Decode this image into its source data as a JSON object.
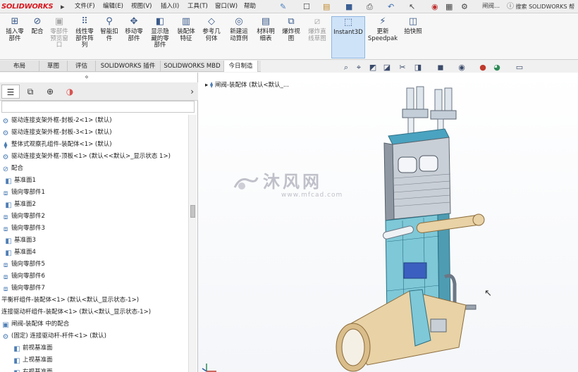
{
  "app": {
    "logo": "SOLIDWORKS"
  },
  "menu": [
    "文件(F)",
    "编辑(E)",
    "视图(V)",
    "插入(I)",
    "工具(T)",
    "窗口(W)",
    "帮助"
  ],
  "window_title": "闸阀...",
  "search_placeholder": "搜索 SOLIDWORKS 帮",
  "ribbon": [
    {
      "label": "插入零\n部件",
      "icon": "insert-component-icon",
      "enabled": true
    },
    {
      "label": "配合",
      "icon": "mate-icon",
      "enabled": true
    },
    {
      "label": "零部件\n预览窗\n口",
      "icon": "preview-window-icon",
      "enabled": false
    },
    {
      "label": "线性零\n部件阵\n列",
      "icon": "linear-pattern-icon",
      "enabled": true
    },
    {
      "label": "智能扣\n件",
      "icon": "smart-fastener-icon",
      "enabled": true
    },
    {
      "label": "移动零\n部件",
      "icon": "move-component-icon",
      "enabled": true
    },
    {
      "label": "显示隐\n藏的零\n部件",
      "icon": "show-hidden-icon",
      "enabled": true
    },
    {
      "label": "装配体\n特征",
      "icon": "assembly-feature-icon",
      "enabled": true
    },
    {
      "label": "参考几\n何体",
      "icon": "reference-geometry-icon",
      "enabled": true
    },
    {
      "label": "新建运\n动算例",
      "icon": "motion-study-icon",
      "enabled": true
    },
    {
      "label": "材料明\n细表",
      "icon": "bom-icon",
      "enabled": true
    },
    {
      "label": "爆炸视\n图",
      "icon": "exploded-view-icon",
      "enabled": true
    },
    {
      "label": "爆炸直\n线草图",
      "icon": "explode-line-icon",
      "enabled": false
    },
    {
      "label": "Instant3D",
      "icon": "instant3d-icon",
      "enabled": true,
      "selected": true
    },
    {
      "label": "更新\nSpeedpak",
      "icon": "speedpak-icon",
      "enabled": true
    },
    {
      "label": "拍快照",
      "icon": "snapshot-icon",
      "enabled": true
    }
  ],
  "tabs": [
    {
      "label": "布局",
      "active": false
    },
    {
      "label": "草图",
      "active": false
    },
    {
      "label": "评估",
      "active": false
    },
    {
      "label": "SOLIDWORKS 插件",
      "active": false
    },
    {
      "label": "SOLIDWORKS MBD",
      "active": false
    },
    {
      "label": "今日制造",
      "active": true
    }
  ],
  "tree": [
    {
      "label": "驱动连接支架外框-封板-2<1> (默认)",
      "icon": "part-icon"
    },
    {
      "label": "驱动连接支架外框-封板-3<1> (默认)",
      "icon": "part-icon"
    },
    {
      "label": "整体式观察孔组件-装配体<1> (默认)",
      "icon": "assembly-icon"
    },
    {
      "label": "驱动连接支架外框-顶板<1> (默认<<默认>_显示状态 1>)",
      "icon": "part-icon"
    },
    {
      "label": "配合",
      "icon": "mate-icon"
    },
    {
      "label": "基准面1",
      "icon": "plane-icon"
    },
    {
      "label": "镜向零部件1",
      "icon": "mirror-icon"
    },
    {
      "label": "基准面2",
      "icon": "plane-icon"
    },
    {
      "label": "镜向零部件2",
      "icon": "mirror-icon"
    },
    {
      "label": "镜向零部件3",
      "icon": "mirror-icon"
    },
    {
      "label": "基准面3",
      "icon": "plane-icon"
    },
    {
      "label": "基准面4",
      "icon": "plane-icon"
    },
    {
      "label": "镜向零部件5",
      "icon": "mirror-icon"
    },
    {
      "label": "镜向零部件6",
      "icon": "mirror-icon"
    },
    {
      "label": "镜向零部件7",
      "icon": "mirror-icon"
    },
    {
      "label": "平衡杆组件-装配体<1> (默认<默认_显示状态-1>)",
      "icon": "none"
    },
    {
      "label": "连接驱动杆组件-装配体<1> (默认<默认_显示状态-1>)",
      "icon": "none"
    },
    {
      "label": "闸阀-装配体 中的配合",
      "icon": "mate-folder-icon"
    },
    {
      "label": "(固定) 连接驱动杆-杆件<1> (默认)",
      "icon": "part-icon"
    },
    {
      "label": "前视基准面",
      "icon": "plane-icon"
    },
    {
      "label": "上视基准面",
      "icon": "plane-icon"
    },
    {
      "label": "右视基准面",
      "icon": "plane-icon"
    }
  ],
  "viewport": {
    "title": "闸阀-装配体  (默认<默认_..."
  },
  "watermark": {
    "main": "沐风网",
    "sub": "www.mfcad.com"
  },
  "colors": {
    "brand": "#d71920",
    "selection": "#cfe3f8",
    "model_cyan": "#7ec8d8",
    "model_tan": "#e8d2a6"
  }
}
